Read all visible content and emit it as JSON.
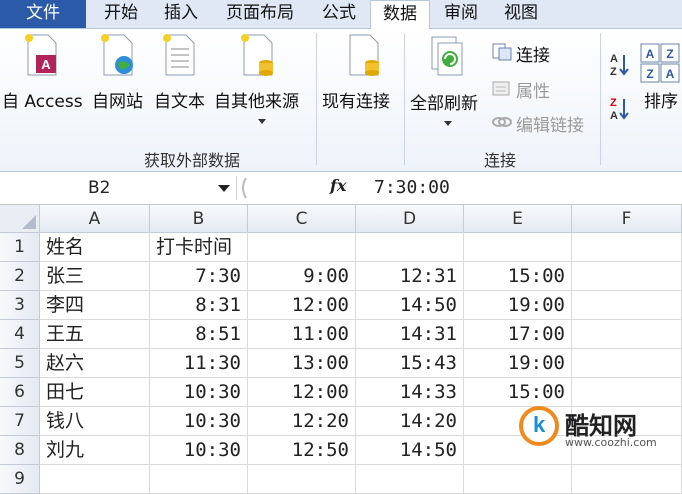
{
  "tabs": {
    "file": "文件",
    "home": "开始",
    "insert": "插入",
    "page_layout": "页面布局",
    "formula": "公式",
    "data": "数据",
    "review": "审阅",
    "view": "视图"
  },
  "ribbon": {
    "external": {
      "access": "自 Access",
      "web": "自网站",
      "text": "自文本",
      "other": "自其他来源",
      "existing": "现有连接",
      "group": "获取外部数据"
    },
    "connections": {
      "refresh_all": "全部刷新",
      "connections": "连接",
      "properties": "属性",
      "edit_links": "编辑链接",
      "group": "连接"
    },
    "sort": {
      "sort": "排序"
    }
  },
  "formula_bar": {
    "name_box": "B2",
    "fx": "fx",
    "value": "7:30:00"
  },
  "grid": {
    "columns": [
      "A",
      "B",
      "C",
      "D",
      "E",
      "F"
    ],
    "rows": [
      "1",
      "2",
      "3",
      "4",
      "5",
      "6",
      "7",
      "8",
      "9"
    ],
    "cells": [
      [
        "姓名",
        "打卡时间",
        "",
        "",
        "",
        ""
      ],
      [
        "张三",
        "7:30",
        "9:00",
        "12:31",
        "15:00",
        ""
      ],
      [
        "李四",
        "8:31",
        "12:00",
        "14:50",
        "19:00",
        ""
      ],
      [
        "王五",
        "8:51",
        "11:00",
        "14:31",
        "17:00",
        ""
      ],
      [
        "赵六",
        "11:30",
        "13:00",
        "15:43",
        "19:00",
        ""
      ],
      [
        "田七",
        "10:30",
        "12:00",
        "14:33",
        "15:00",
        ""
      ],
      [
        "钱八",
        "10:30",
        "12:20",
        "14:20",
        "",
        ""
      ],
      [
        "刘九",
        "10:30",
        "12:50",
        "14:50",
        "",
        ""
      ],
      [
        "",
        "",
        "",
        "",
        "",
        ""
      ]
    ]
  },
  "watermark": {
    "name": "酷知网",
    "url": "www.coozhi.com"
  },
  "colors": {
    "file_tab": "#2a5aa8",
    "accent": "#f08a1c"
  }
}
